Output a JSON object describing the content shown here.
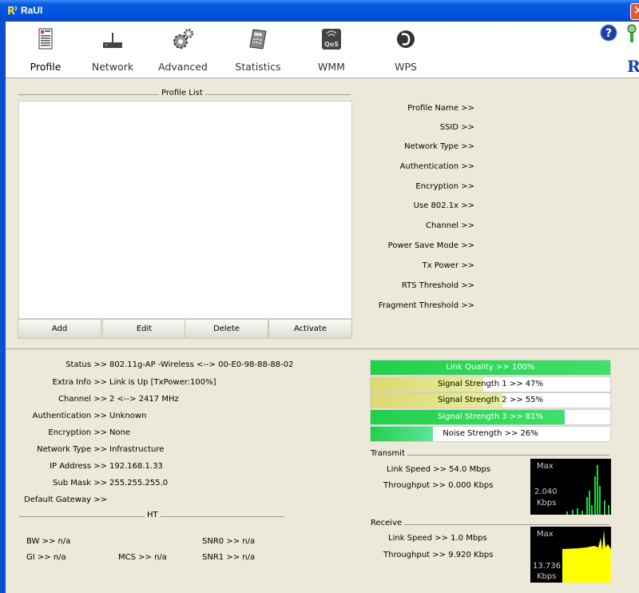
{
  "window": {
    "title": "RaUI",
    "close_glyph": "✕"
  },
  "toolbar": {
    "items": [
      {
        "label": "Profile",
        "icon": "profile-icon"
      },
      {
        "label": "Network",
        "icon": "network-icon"
      },
      {
        "label": "Advanced",
        "icon": "advanced-icon"
      },
      {
        "label": "Statistics",
        "icon": "statistics-icon"
      },
      {
        "label": "WMM",
        "icon": "wmm-icon",
        "icon_text": "QoS"
      },
      {
        "label": "WPS",
        "icon": "wps-icon"
      }
    ],
    "help_glyph": "?",
    "brand_letter": "R"
  },
  "profile_list": {
    "title": "Profile List",
    "buttons": [
      "Add",
      "Edit",
      "Delete",
      "Activate"
    ]
  },
  "profile_details": [
    "Profile Name >>",
    "SSID >>",
    "Network Type >>",
    "Authentication >>",
    "Encryption >>",
    "Use 802.1x >>",
    "Channel >>",
    "Power Save Mode >>",
    "Tx Power >>",
    "RTS Threshold >>",
    "Fragment Threshold >>"
  ],
  "status": [
    {
      "key": "Status >>",
      "value": "802.11g-AP -Wireless  <--> 00-E0-98-88-88-02"
    },
    {
      "key": "Extra Info >>",
      "value": "Link is Up [TxPower:100%]"
    },
    {
      "key": "Channel >>",
      "value": "2 <--> 2417 MHz"
    },
    {
      "key": "Authentication >>",
      "value": "Unknown"
    },
    {
      "key": "Encryption >>",
      "value": "None"
    },
    {
      "key": "Network Type >>",
      "value": "Infrastructure"
    },
    {
      "key": "IP Address >>",
      "value": "192.168.1.33"
    },
    {
      "key": "Sub Mask >>",
      "value": "255.255.255.0"
    },
    {
      "key": "Default Gateway >>",
      "value": ""
    }
  ],
  "ht": {
    "title": "HT",
    "bw": "BW >> n/a",
    "gi": "GI >> n/a",
    "mcs": "MCS >> n/a",
    "snr0": "SNR0 >> n/a",
    "snr1": "SNR1 >> n/a"
  },
  "signal": {
    "link_quality": {
      "label": "Link Quality >> 100%",
      "percent": 100
    },
    "signal1": {
      "label": "Signal Strength 1 >> 47%",
      "percent": 47
    },
    "signal2": {
      "label": "Signal Strength 2 >> 55%",
      "percent": 55
    },
    "signal3": {
      "label": "Signal Strength 3 >> 81%",
      "percent": 81
    },
    "noise": {
      "label": "Noise Strength >> 26%",
      "percent": 26
    }
  },
  "transmit": {
    "title": "Transmit",
    "link_speed": "Link Speed >> 54.0 Mbps",
    "throughput": "Throughput >> 0.000 Kbps",
    "graph_max": "Max",
    "graph_value": "2.040",
    "graph_unit": "Kbps"
  },
  "receive": {
    "title": "Receive",
    "link_speed": "Link Speed >> 1.0 Mbps",
    "throughput": "Throughput >> 9.920 Kbps",
    "graph_max": "Max",
    "graph_value": "13.736",
    "graph_unit": "Kbps"
  },
  "colors": {
    "title_bar": "#0054e3",
    "bar_green": "#22d04a",
    "bar_yellow": "#dcd870",
    "graph_green": "#22d04a",
    "graph_yellow": "#ffff00"
  }
}
